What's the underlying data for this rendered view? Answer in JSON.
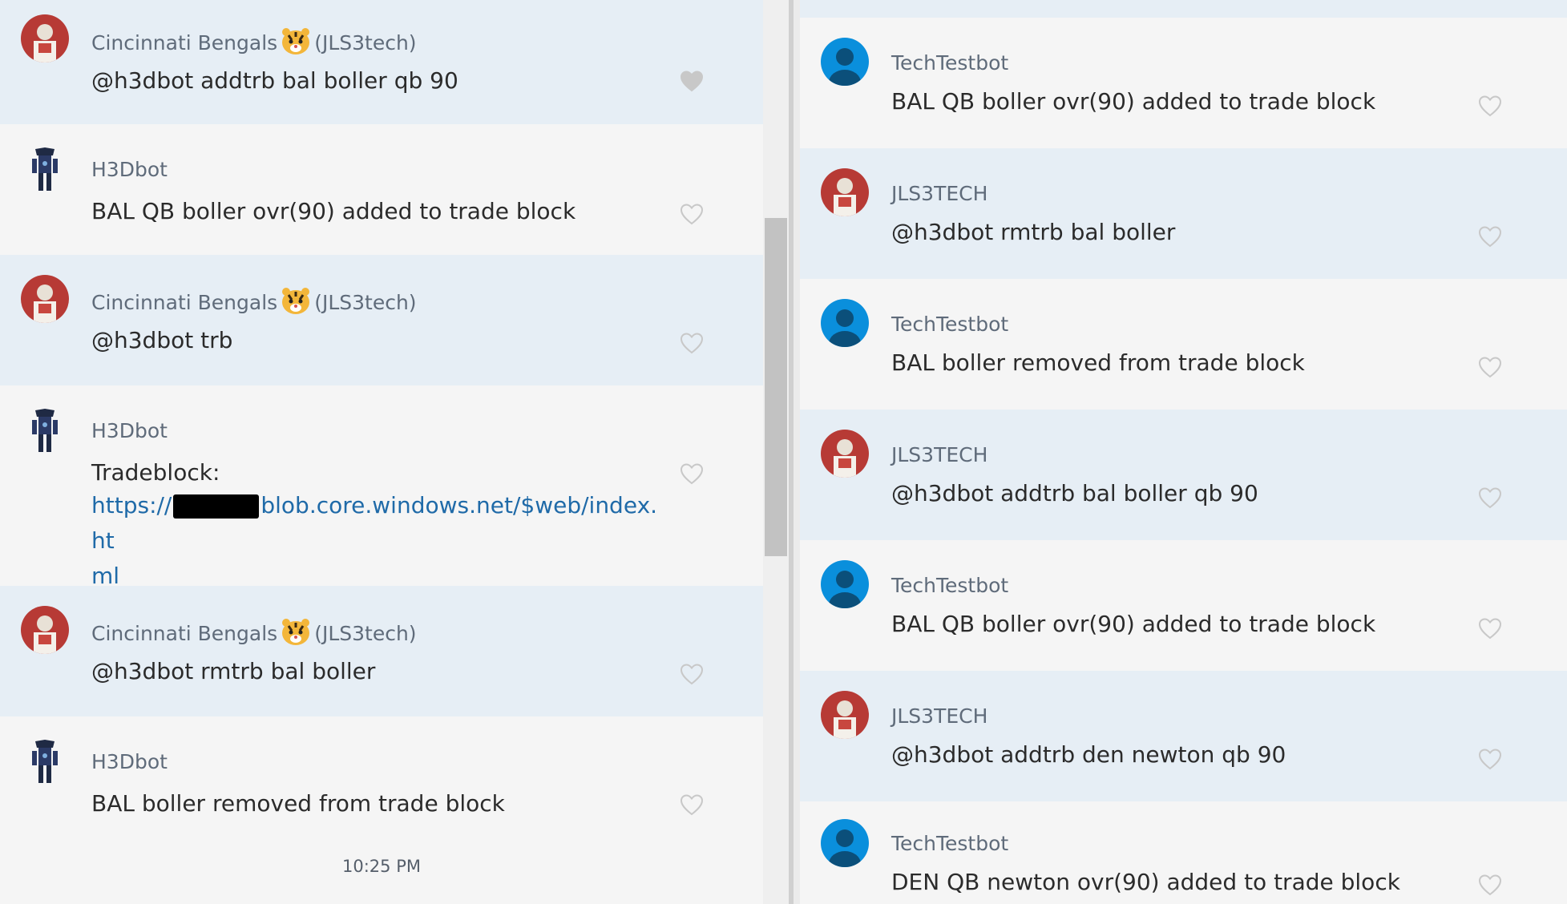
{
  "left": {
    "messages": [
      {
        "author": "Cincinnati Bengals",
        "handle": "(JLS3tech)",
        "text": "@h3dbot addtrb bal boller qb 90"
      },
      {
        "author": "H3Dbot",
        "text": "BAL QB boller ovr(90) added to trade block"
      },
      {
        "author": "Cincinnati Bengals",
        "handle": "(JLS3tech)",
        "text": "@h3dbot trb"
      },
      {
        "author": "H3Dbot",
        "text": "Tradeblock:",
        "link_start": "https://",
        "link_end": "blob.core.windows.net/$web/index.ht",
        "link_wrap": "ml"
      },
      {
        "author": "Cincinnati Bengals",
        "handle": "(JLS3tech)",
        "text": "@h3dbot rmtrb bal boller"
      },
      {
        "author": "H3Dbot",
        "text": "BAL boller removed from trade block"
      }
    ],
    "timestamp": "10:25 PM"
  },
  "right": {
    "messages": [
      {
        "author": "TechTestbot",
        "text": "BAL QB boller ovr(90) added to trade block"
      },
      {
        "author": "JLS3TECH",
        "text": "@h3dbot rmtrb bal boller"
      },
      {
        "author": "TechTestbot",
        "text": "BAL boller removed from trade block"
      },
      {
        "author": "JLS3TECH",
        "text": "@h3dbot addtrb bal boller qb 90"
      },
      {
        "author": "TechTestbot",
        "text": "BAL QB boller ovr(90) added to trade block"
      },
      {
        "author": "JLS3TECH",
        "text": "@h3dbot addtrb den newton qb 90"
      },
      {
        "author": "TechTestbot",
        "text": "DEN QB newton ovr(90) added to trade block"
      }
    ]
  },
  "icons": {
    "like": "heart-icon",
    "team_emoji": "tiger-face-icon",
    "bot_avatar": "robot-avatar-icon",
    "user_avatar": "person-avatar-icon"
  },
  "colors": {
    "highlight_row": "#e6eef5",
    "plain_row": "#f5f5f5",
    "author_text": "#5f6b7a",
    "link": "#1f6aa8",
    "default_avatar": "#0a8fdc"
  }
}
